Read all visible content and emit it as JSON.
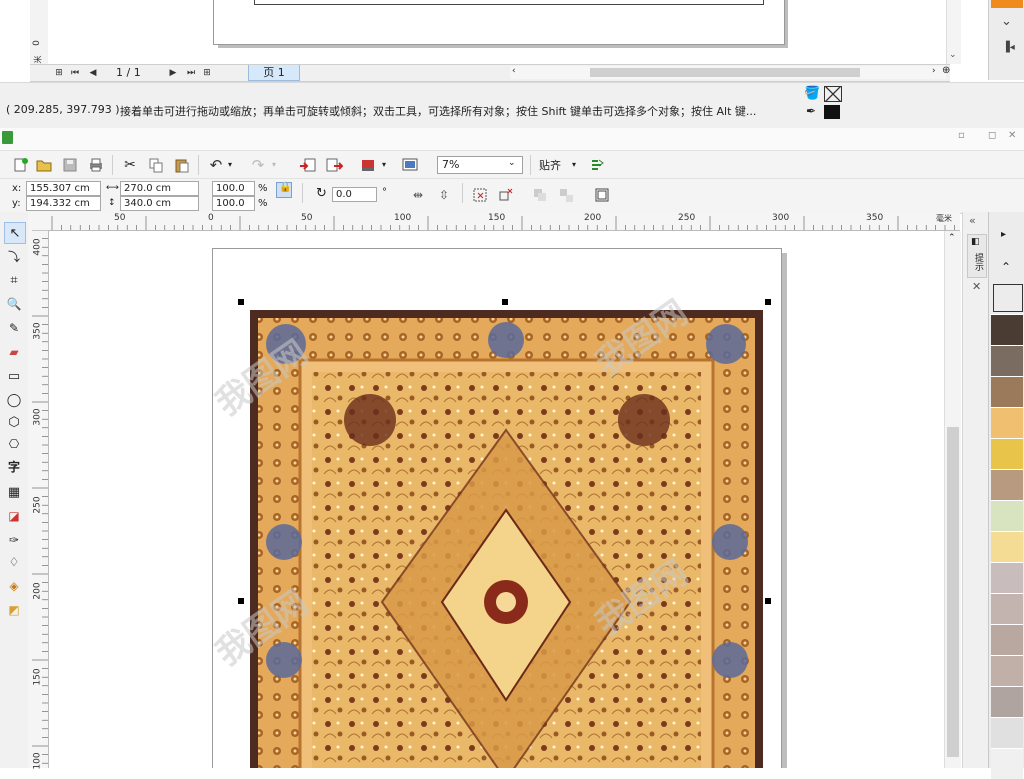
{
  "previous_window": {
    "ruler_tick": "0",
    "ruler_unit": "毫米",
    "page_counter": "1 / 1",
    "page_tab": "页 1",
    "status_coords": "( 209.285, 397.793 )",
    "status_hint": "接着单击可进行拖动或缩放；再单击可旋转或倾斜；双击工具，可选择所有对象；按住 Shift 键单击可选择多个对象；按住 Alt 键..."
  },
  "window_controls": {
    "minimize": "▫",
    "restore": "◻",
    "close": "✕"
  },
  "toolbar": {
    "zoom_value": "7%",
    "snap_label": "贴齐"
  },
  "property_bar": {
    "x_label": "x:",
    "x_value": "155.307 cm",
    "y_label": "y:",
    "y_value": "194.332 cm",
    "width_value": "270.0 cm",
    "height_value": "340.0 cm",
    "scale_w": "100.0",
    "scale_h": "100.0",
    "percent": "%",
    "rotation": "0.0",
    "degree": "°"
  },
  "toolbox": {
    "text_tool_glyph": "字"
  },
  "rulers": {
    "h_ticks": [
      "50",
      "0",
      "50",
      "100",
      "150",
      "200",
      "250",
      "300",
      "350"
    ],
    "h_unit": "毫米",
    "v_ticks": [
      "400",
      "350",
      "300",
      "250",
      "200",
      "150",
      "100"
    ]
  },
  "docker": {
    "tab_label": "提示"
  },
  "palette": {
    "prev_colors": [
      "#f08a1c"
    ],
    "colors": [
      "#4a3b33",
      "#7a6c60",
      "#9a7a5a",
      "#f0c070",
      "#e8c44a",
      "#b89a80",
      "#d8e4c0",
      "#f4dc94",
      "#c8bcbc",
      "#c4b4b0",
      "#b8a8a0",
      "#c0b0a8",
      "#b0a4a0",
      "#e0e0e0",
      "#f0f0f0"
    ]
  },
  "watermark_text": "我图网"
}
